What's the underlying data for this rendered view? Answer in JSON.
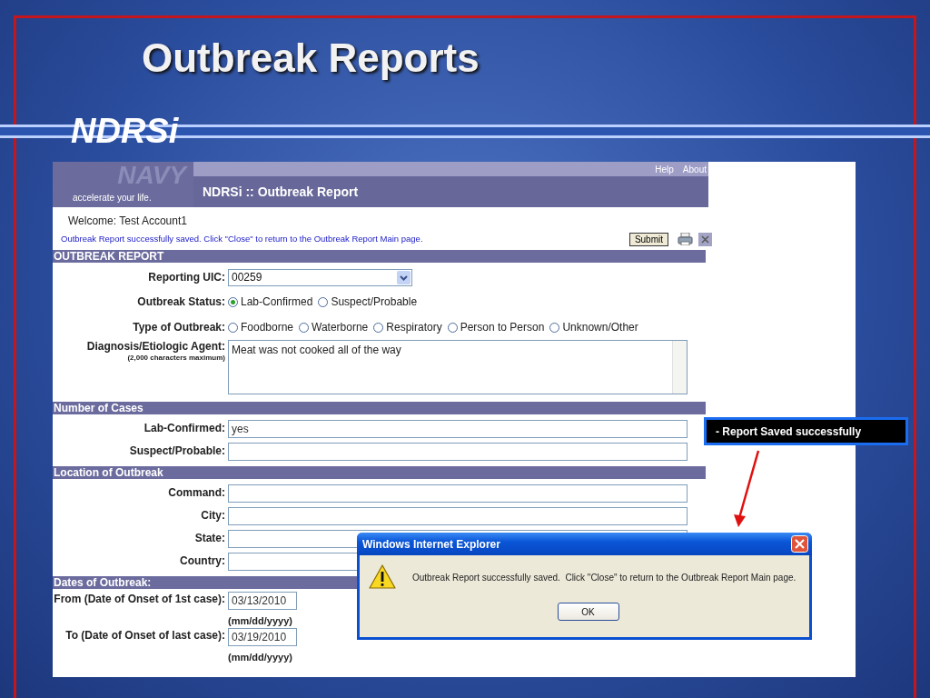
{
  "slide": {
    "title": "Outbreak Reports",
    "subtitle": "NDRSi",
    "callout": "- Report Saved successfully"
  },
  "app": {
    "logo_word": "NAVY",
    "logo_tagline": "accelerate your life.",
    "top_links": [
      "Help",
      "About"
    ],
    "page_title": "NDRSi :: Outbreak Report",
    "welcome": "Welcome: Test Account1",
    "status_message": "Outbreak Report successfully saved. Click \"Close\" to return to the Outbreak Report Main page.",
    "submit": "Submit",
    "sections": [
      {
        "title": "OUTBREAK REPORT",
        "rows": [
          {
            "kind": "select",
            "label": "Reporting UIC:",
            "value": "00259"
          },
          {
            "kind": "radio",
            "label": "Outbreak Status:",
            "options": [
              {
                "label": "Lab-Confirmed",
                "selected": true
              },
              {
                "label": "Suspect/Probable",
                "selected": false
              }
            ]
          },
          {
            "kind": "radio",
            "label": "Type of Outbreak:",
            "options": [
              {
                "label": "Foodborne",
                "selected": false
              },
              {
                "label": "Waterborne",
                "selected": false
              },
              {
                "label": "Respiratory",
                "selected": false
              },
              {
                "label": "Person to Person",
                "selected": false
              },
              {
                "label": "Unknown/Other",
                "selected": false
              }
            ]
          },
          {
            "kind": "textarea",
            "label": "Diagnosis/Etiologic Agent:",
            "sublabel": "(2,000 characters maximum)",
            "value": "Meat was not cooked all of the way"
          }
        ]
      },
      {
        "title": "Number of Cases",
        "rows": [
          {
            "kind": "text",
            "label": "Lab-Confirmed:",
            "value": "yes"
          },
          {
            "kind": "text",
            "label": "Suspect/Probable:"
          }
        ]
      },
      {
        "title": "Location of Outbreak",
        "rows": [
          {
            "kind": "text",
            "label": "Command:"
          },
          {
            "kind": "text",
            "label": "City:"
          },
          {
            "kind": "text",
            "label": "State:"
          },
          {
            "kind": "text",
            "label": "Country:"
          }
        ]
      },
      {
        "title": "Dates of Outbreak:",
        "rows": [
          {
            "kind": "date",
            "label": "From (Date of Onset of 1st case):",
            "value": "03/13/2010",
            "hint": "(mm/dd/yyyy)"
          },
          {
            "kind": "date",
            "label": "To (Date of Onset of last case):",
            "value": "03/19/2010",
            "hint": "(mm/dd/yyyy)"
          }
        ]
      }
    ]
  },
  "dialog": {
    "title": "Windows Internet Explorer",
    "message": "Outbreak Report successfully saved.  Click \"Close\" to return to the Outbreak Report Main page.",
    "button": "OK"
  }
}
